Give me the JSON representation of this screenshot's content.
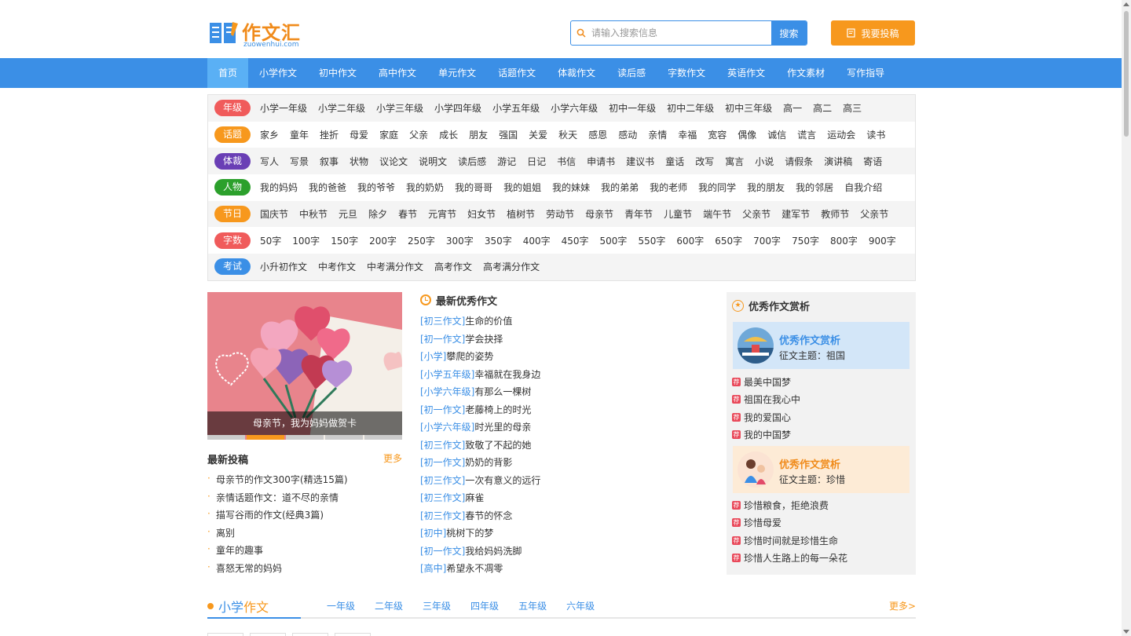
{
  "brand": {
    "name": "作文汇",
    "domain": "zuowenhui.com",
    "accent": "#3b8fe6",
    "orange": "#f7981d"
  },
  "search": {
    "placeholder": "请输入搜索信息",
    "button": "搜索"
  },
  "submit_button": "我要投稿",
  "nav": [
    "首页",
    "小学作文",
    "初中作文",
    "高中作文",
    "单元作文",
    "话题作文",
    "体裁作文",
    "读后感",
    "字数作文",
    "英语作文",
    "作文素材",
    "写作指导"
  ],
  "categories": [
    {
      "label": "年级",
      "color": "#f05b5b",
      "links": [
        "小学一年级",
        "小学二年级",
        "小学三年级",
        "小学四年级",
        "小学五年级",
        "小学六年级",
        "初中一年级",
        "初中二年级",
        "初中三年级",
        "高一",
        "高二",
        "高三"
      ]
    },
    {
      "label": "话题",
      "color": "#f7981d",
      "links": [
        "家乡",
        "童年",
        "挫折",
        "母爱",
        "家庭",
        "父亲",
        "成长",
        "朋友",
        "强国",
        "关爱",
        "秋天",
        "感恩",
        "感动",
        "亲情",
        "幸福",
        "宽容",
        "偶像",
        "诚信",
        "谎言",
        "运动会",
        "读书"
      ]
    },
    {
      "label": "体裁",
      "color": "#6a3fb5",
      "links": [
        "写人",
        "写景",
        "叙事",
        "状物",
        "议论文",
        "说明文",
        "读后感",
        "游记",
        "日记",
        "书信",
        "申请书",
        "建议书",
        "童话",
        "改写",
        "寓言",
        "小说",
        "请假条",
        "演讲稿",
        "寄语"
      ]
    },
    {
      "label": "人物",
      "color": "#2ca02c",
      "links": [
        "我的妈妈",
        "我的爸爸",
        "我的爷爷",
        "我的奶奶",
        "我的哥哥",
        "我的姐姐",
        "我的妹妹",
        "我的弟弟",
        "我的老师",
        "我的同学",
        "我的朋友",
        "我的邻居",
        "自我介绍"
      ]
    },
    {
      "label": "节日",
      "color": "#f7981d",
      "links": [
        "国庆节",
        "中秋节",
        "元旦",
        "除夕",
        "春节",
        "元宵节",
        "妇女节",
        "植树节",
        "劳动节",
        "母亲节",
        "青年节",
        "儿童节",
        "端午节",
        "父亲节",
        "建军节",
        "教师节",
        "父亲节"
      ]
    },
    {
      "label": "字数",
      "color": "#f05b5b",
      "links": [
        "50字",
        "100字",
        "150字",
        "200字",
        "250字",
        "300字",
        "350字",
        "400字",
        "450字",
        "500字",
        "550字",
        "600字",
        "650字",
        "700字",
        "750字",
        "800字",
        "900字"
      ]
    },
    {
      "label": "考试",
      "color": "#3b8fe6",
      "links": [
        "小升初作文",
        "中考作文",
        "中考满分作文",
        "高考作文",
        "高考满分作文"
      ]
    }
  ],
  "slider": {
    "caption": "母亲节，我为妈妈做贺卡",
    "active_index": 1,
    "count": 5
  },
  "submissions": {
    "title": "最新投稿",
    "more": "更多",
    "items": [
      "母亲节的作文300字(精选15篇)",
      "亲情话题作文：道不尽的亲情",
      "描写谷雨的作文(经典3篇)",
      "离别",
      "童年的趣事",
      "喜怒无常的妈妈"
    ]
  },
  "latest": {
    "title": "最新优秀作文",
    "items": [
      {
        "tag": "[初三作文]",
        "title": "生命的价值"
      },
      {
        "tag": "[初一作文]",
        "title": "学会抉择"
      },
      {
        "tag": "[小学]",
        "title": "攀爬的姿势"
      },
      {
        "tag": "[小学五年级]",
        "title": "幸福就在我身边"
      },
      {
        "tag": "[小学六年级]",
        "title": "有那么一棵树"
      },
      {
        "tag": "[初一作文]",
        "title": "老藤椅上的时光"
      },
      {
        "tag": "[小学六年级]",
        "title": "时光里的母亲"
      },
      {
        "tag": "[初三作文]",
        "title": "致敬了不起的她"
      },
      {
        "tag": "[初一作文]",
        "title": "奶奶的背影"
      },
      {
        "tag": "[初三作文]",
        "title": "一次有意义的远行"
      },
      {
        "tag": "[初三作文]",
        "title": "麻雀"
      },
      {
        "tag": "[初三作文]",
        "title": "春节的怀念"
      },
      {
        "tag": "[初中]",
        "title": "桃树下的梦"
      },
      {
        "tag": "[初一作文]",
        "title": "我给妈妈洗脚"
      },
      {
        "tag": "[高中]",
        "title": "希望永不凋零"
      }
    ]
  },
  "appreciation": {
    "title": "优秀作文赏析",
    "rec_icon": "荐",
    "cards": [
      {
        "title": "优秀作文赏析",
        "subtitle": "征文主题：祖国",
        "items": [
          "最美中国梦",
          "祖国在我心中",
          "我的爱国心",
          "我的中国梦"
        ]
      },
      {
        "title": "优秀作文赏析",
        "subtitle": "征文主题：珍惜",
        "items": [
          "珍惜粮食，拒绝浪费",
          "珍惜母爱",
          "珍惜时间就是珍惜生命",
          "珍惜人生路上的每一朵花"
        ]
      }
    ]
  },
  "section": {
    "title_a": "小学",
    "title_b": "作文",
    "tabs": [
      "一年级",
      "二年级",
      "三年级",
      "四年级",
      "五年级",
      "六年级"
    ],
    "more": "更多>"
  }
}
